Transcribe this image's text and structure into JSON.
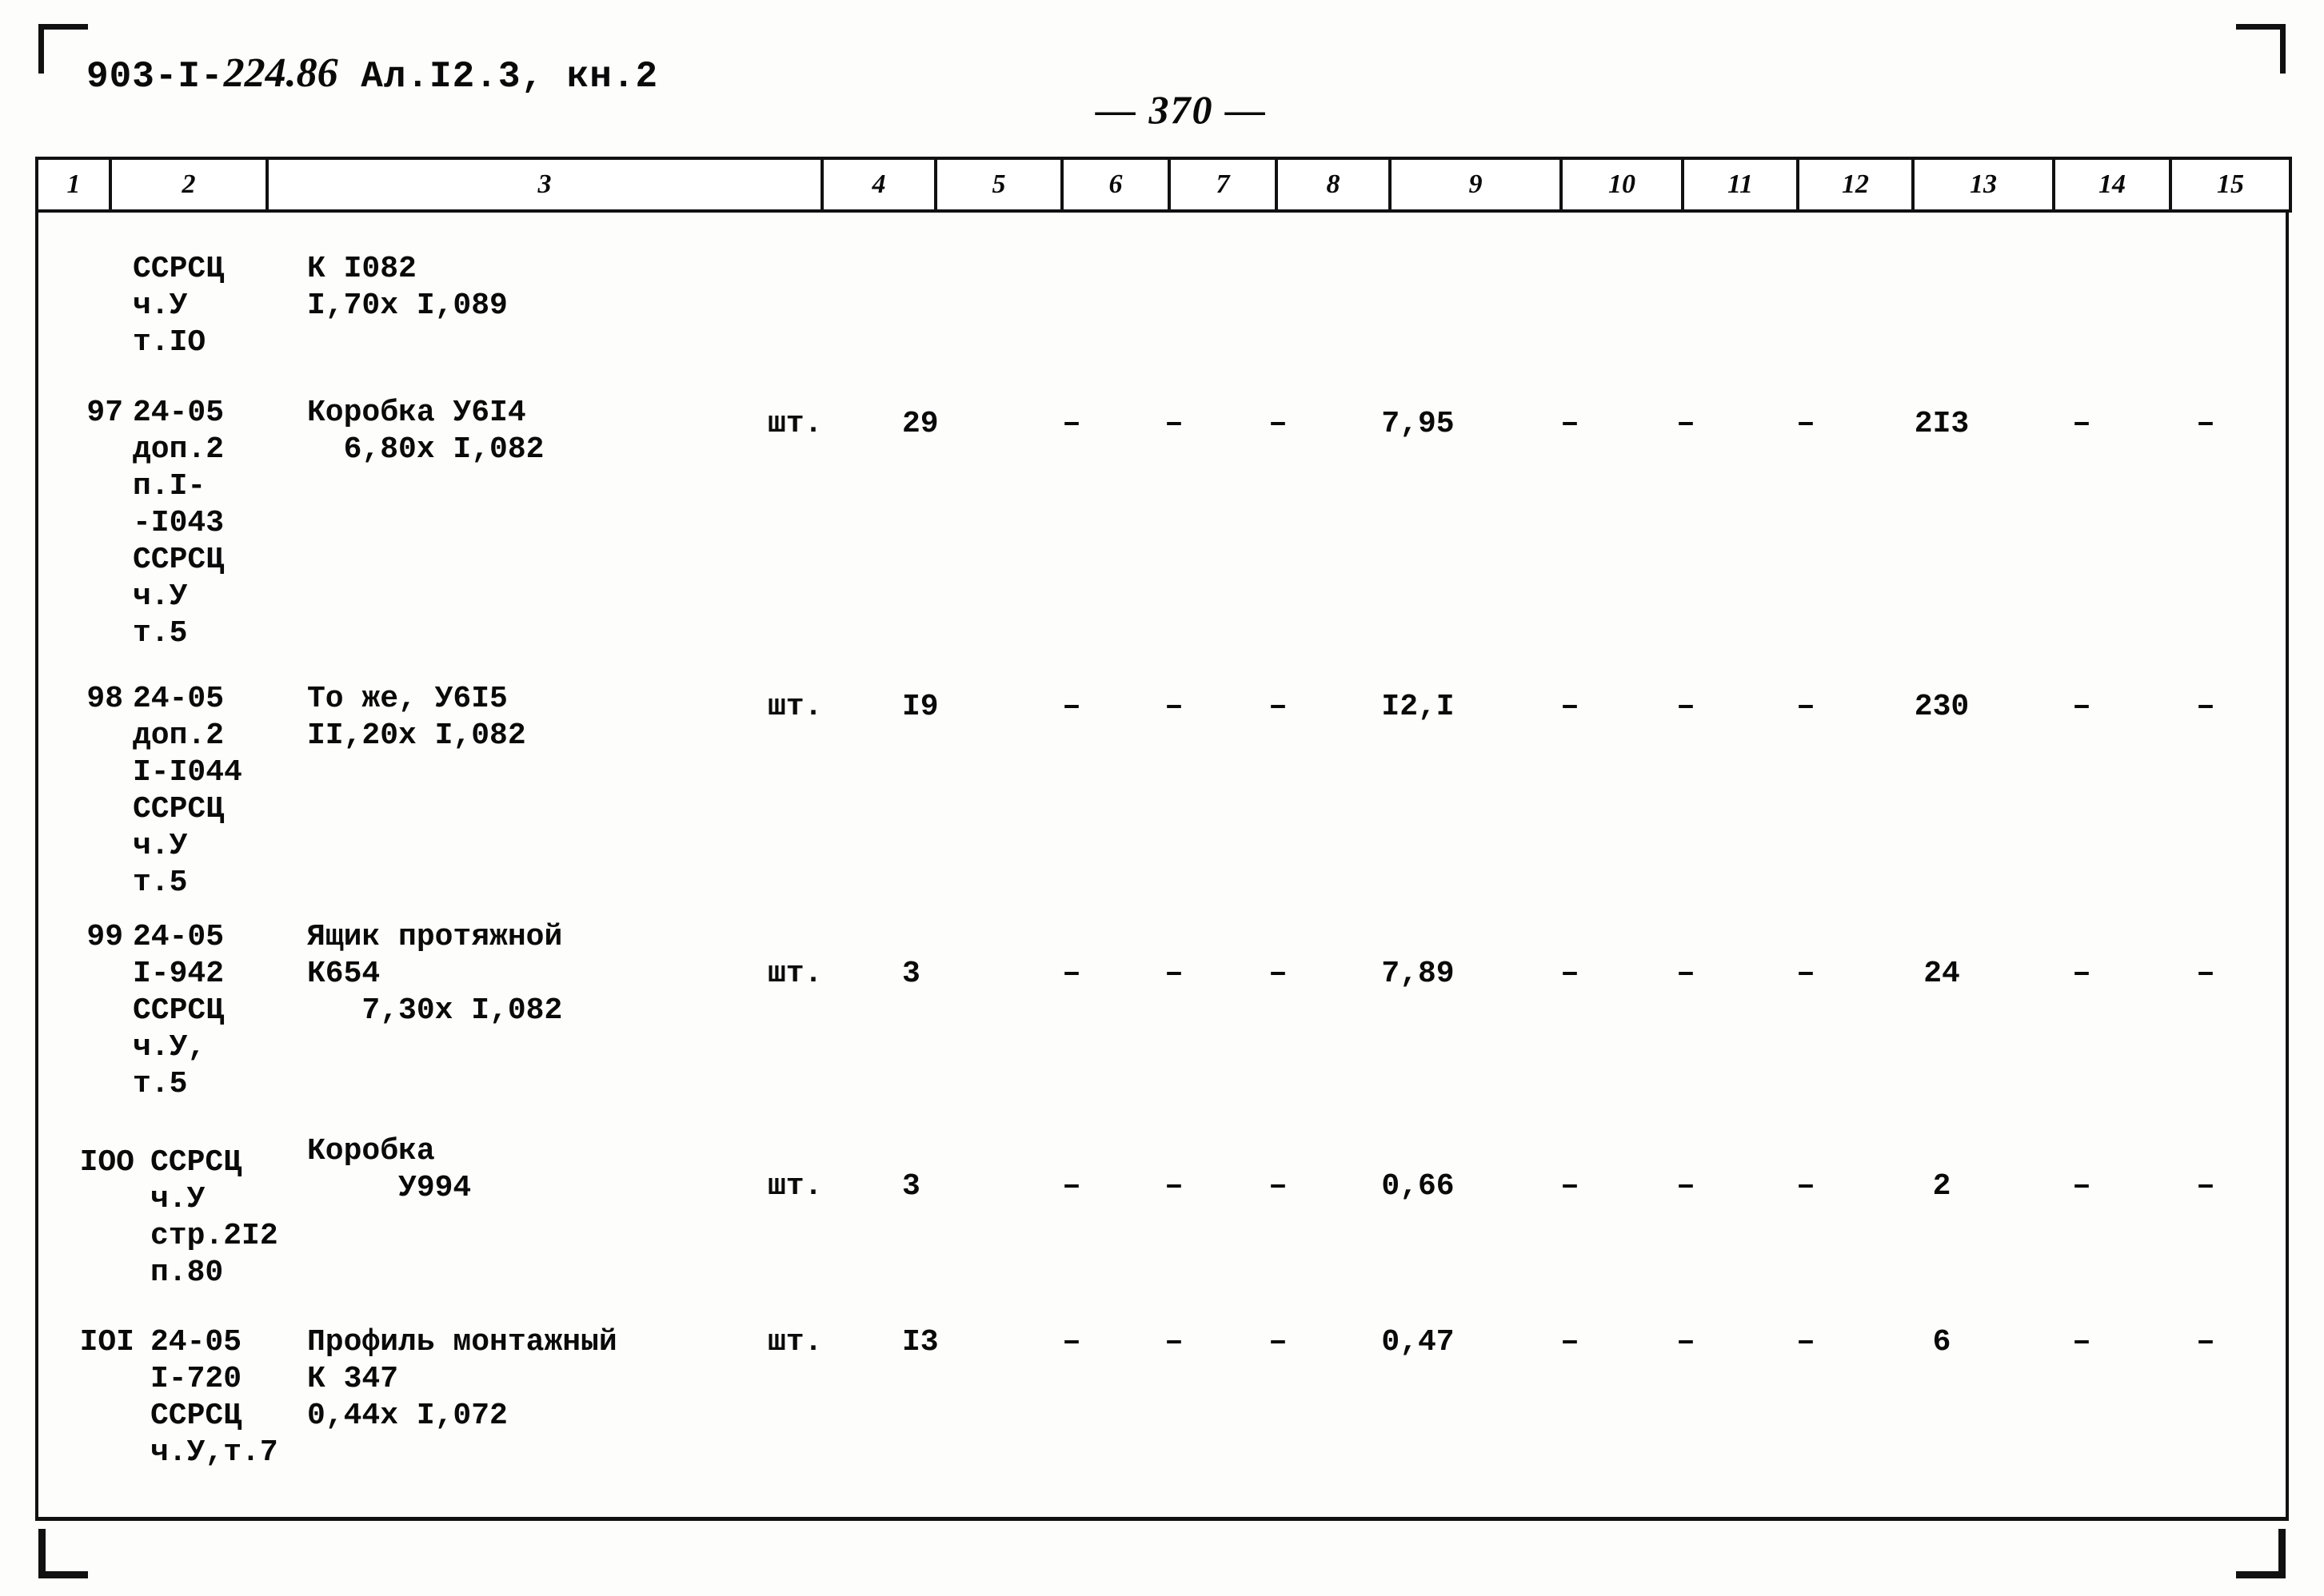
{
  "document": {
    "code_prefix": "903-I-",
    "code_hand": "224.86",
    "code_suffix": " Ал.I2.3, кн.2",
    "page_number": "— 370 —"
  },
  "table": {
    "column_headers": [
      "1",
      "2",
      "3",
      "4",
      "5",
      "6",
      "7",
      "8",
      "9",
      "10",
      "11",
      "12",
      "13",
      "14",
      "15"
    ],
    "dash": "–",
    "rows": [
      {
        "num": "",
        "col2": "ССРСЦ\nч.У\nт.IO",
        "col3": "К I082\nI,70х I,089",
        "col4": "",
        "col5": "",
        "col6": "",
        "col7": "",
        "col8": "",
        "col9": "",
        "col10": "",
        "col11": "",
        "col12": "",
        "col13": "",
        "col14": "",
        "col15": ""
      },
      {
        "num": "97",
        "col2": "24-05\nдоп.2\nп.I-\n-I043\nССРСЦ\nч.У\nт.5",
        "col3": "Коробка У6I4\n  6,80х I,082",
        "col4": "шт.",
        "col5": "29",
        "col6": "–",
        "col7": "–",
        "col8": "–",
        "col9": "7,95",
        "col10": "–",
        "col11": "–",
        "col12": "–",
        "col13": "2I3",
        "col14": "–",
        "col15": "–"
      },
      {
        "num": "98",
        "col2": "24-05\nдоп.2\nI-I044\nССРСЦ\nч.У\nт.5",
        "col3": "То же, У6I5\nII,20х I,082",
        "col4": "шт.",
        "col5": "I9",
        "col6": "–",
        "col7": "–",
        "col8": "–",
        "col9": "I2,I",
        "col10": "–",
        "col11": "–",
        "col12": "–",
        "col13": "230",
        "col14": "–",
        "col15": "–"
      },
      {
        "num": "99",
        "col2": "24-05\nI-942\nССРСЦ\nч.У,\nт.5",
        "col3": "Ящик протяжной\nК654\n   7,30х I,082",
        "col4": "шт.",
        "col5": "3",
        "col6": "–",
        "col7": "–",
        "col8": "–",
        "col9": "7,89",
        "col10": "–",
        "col11": "–",
        "col12": "–",
        "col13": "24",
        "col14": "–",
        "col15": "–"
      },
      {
        "num": "IOO",
        "col2": "ССРСЦ\nч.У\nстр.2I2\nп.80",
        "col3": "Коробка\n     У994",
        "col4": "шт.",
        "col5": "3",
        "col6": "–",
        "col7": "–",
        "col8": "–",
        "col9": "0,66",
        "col10": "–",
        "col11": "–",
        "col12": "–",
        "col13": "2",
        "col14": "–",
        "col15": "–"
      },
      {
        "num": "IOI",
        "col2": "24-05\nI-720\nССРСЦ\nч.У,т.7",
        "col3": "Профиль монтажный\nК 347\n0,44х I,072",
        "col4": "шт.",
        "col5": "I3",
        "col6": "–",
        "col7": "–",
        "col8": "–",
        "col9": "0,47",
        "col10": "–",
        "col11": "–",
        "col12": "–",
        "col13": "6",
        "col14": "–",
        "col15": "–"
      }
    ]
  }
}
